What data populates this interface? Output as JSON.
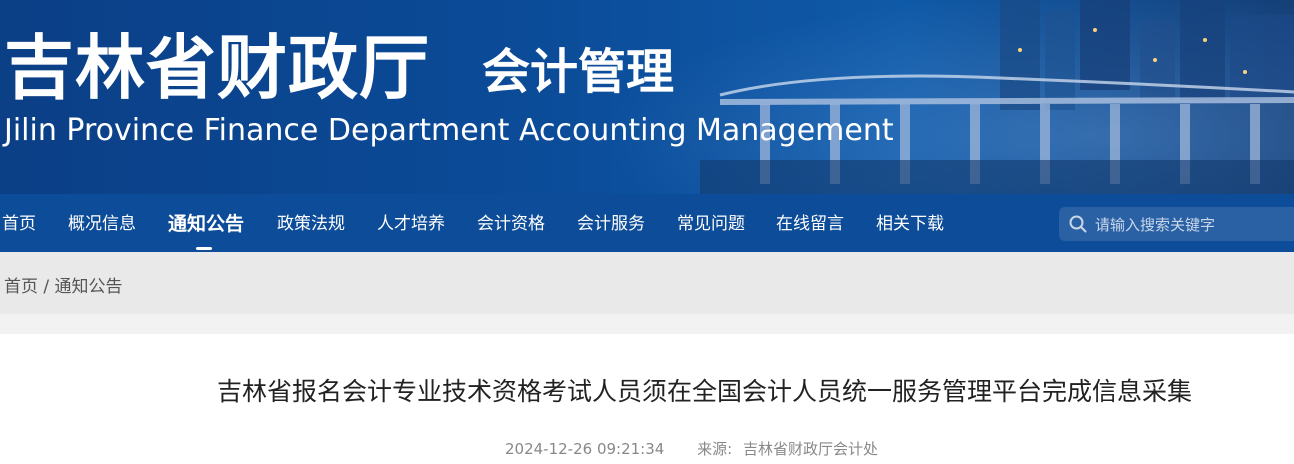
{
  "header": {
    "title": "吉林省财政厅",
    "subtitle": "会计管理",
    "english": "Jilin Province Finance Department Accounting Management"
  },
  "nav": {
    "items": [
      {
        "label": "首页"
      },
      {
        "label": "概况信息"
      },
      {
        "label": "通知公告",
        "active": true
      },
      {
        "label": "政策法规"
      },
      {
        "label": "人才培养"
      },
      {
        "label": "会计资格"
      },
      {
        "label": "会计服务"
      },
      {
        "label": "常见问题"
      },
      {
        "label": "在线留言"
      },
      {
        "label": "相关下载"
      }
    ],
    "search_placeholder": "请输入搜索关键字"
  },
  "breadcrumb": {
    "home": "首页",
    "separator": "/",
    "current": "通知公告"
  },
  "article": {
    "title": "吉林省报名会计专业技术资格考试人员须在全国会计人员统一服务管理平台完成信息采集",
    "date": "2024-12-26 09:21:34",
    "source_label": "来源:",
    "source": "吉林省财政厅会计处"
  },
  "colors": {
    "nav_bg": "#0d4c98",
    "banner_bg": "#0b4b98",
    "crumb_bg": "#e9e9ea"
  }
}
